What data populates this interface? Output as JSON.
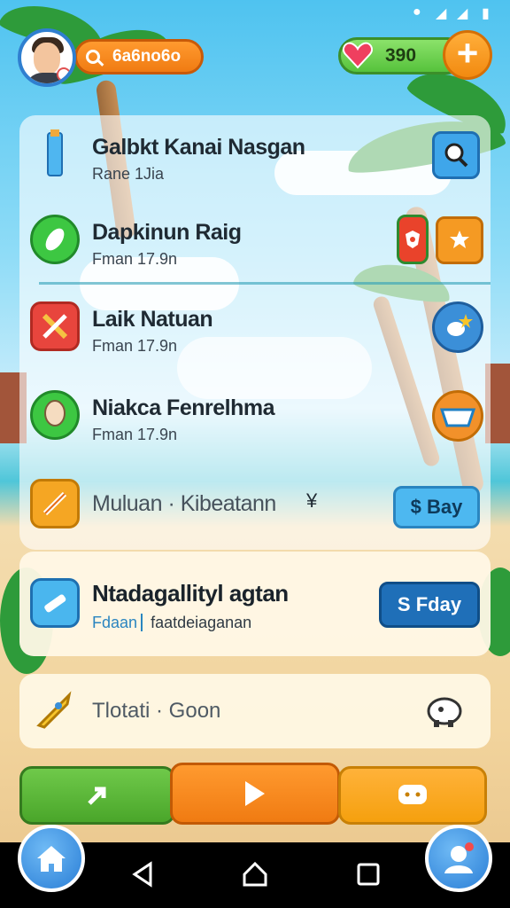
{
  "header": {
    "search_value": "6a6no6o",
    "coins_value": "390"
  },
  "list": [
    {
      "title": "Galbkt Kanai Nasgan",
      "sub": "Rane 1Jia"
    },
    {
      "title": "Dapkinun Raig",
      "sub": "Fman 17.9n"
    },
    {
      "title": "Laik Natuan",
      "sub": "Fman 17.9n"
    },
    {
      "title": "Niakca Fenrelhma",
      "sub": "Fman 17.9n"
    },
    {
      "title": "Muluan · Kibeatann",
      "sub": "",
      "extra": "¥",
      "button": "$ Bay"
    }
  ],
  "card": {
    "title": "Ntadagallityl agtan",
    "sub_prefix": "Fdaan",
    "sub_rest": "faatdeiaganan",
    "button": "S Fday"
  },
  "card2": {
    "label": "Tlotati · Goon"
  },
  "colors": {
    "orange": "#f28a10",
    "green": "#56c23c",
    "blue": "#2a7ed6",
    "panel": "#ffffff"
  }
}
